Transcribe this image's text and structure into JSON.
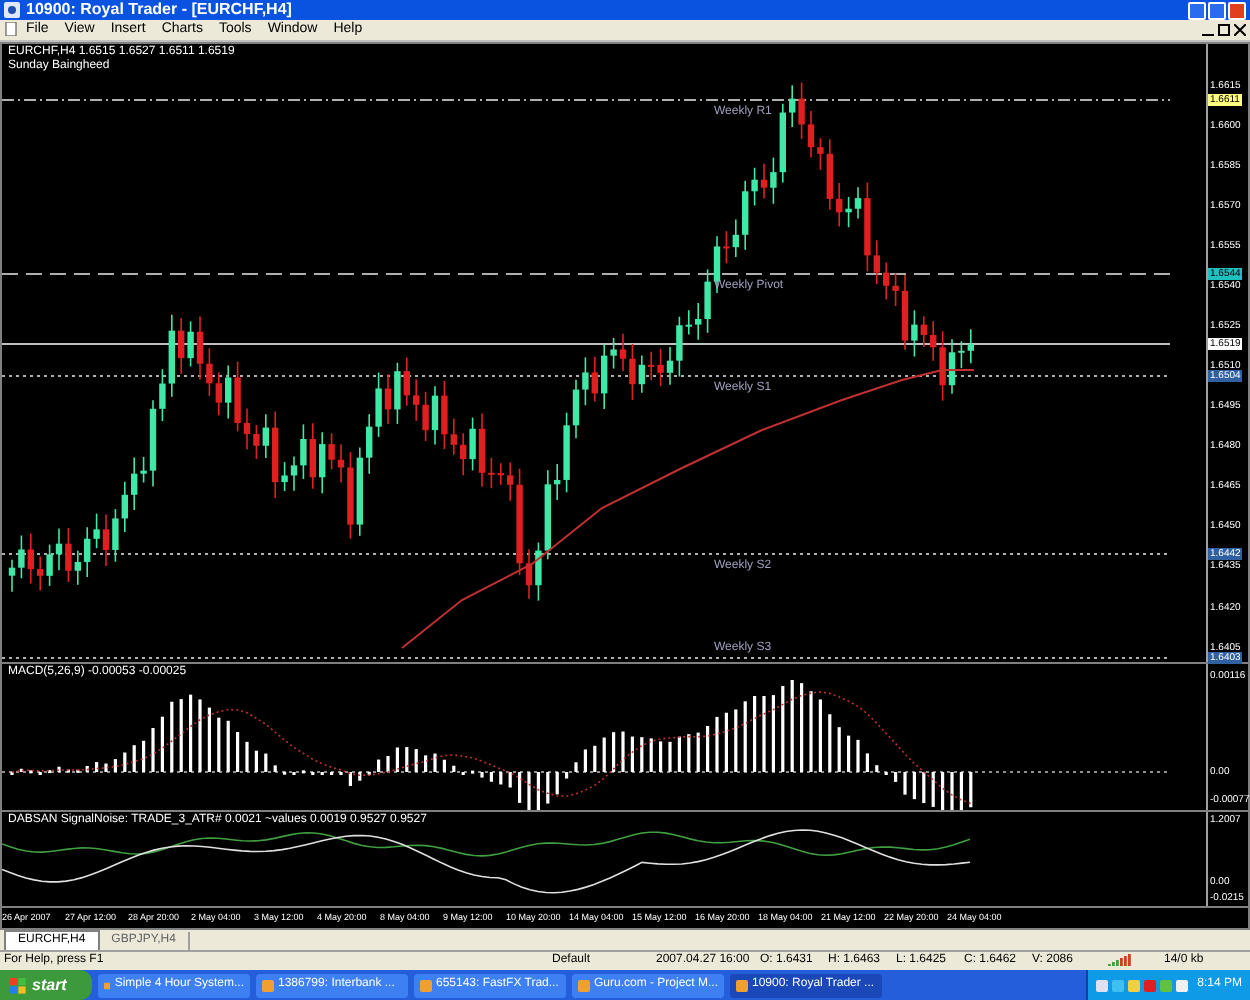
{
  "window": {
    "title": "10900: Royal Trader - [EURCHF,H4]"
  },
  "menu": [
    "File",
    "View",
    "Insert",
    "Charts",
    "Tools",
    "Window",
    "Help"
  ],
  "chart": {
    "header": [
      "EURCHF,H4  1.6515 1.6527 1.6511 1.6519",
      "Sunday Baingheed"
    ],
    "price_ticks": [
      "1.6615",
      "1.6600",
      "1.6585",
      "1.6570",
      "1.6555",
      "1.6540",
      "1.6525",
      "1.6510",
      "1.6495",
      "1.6480",
      "1.6465",
      "1.6450",
      "1.6435",
      "1.6420",
      "1.6405"
    ],
    "levels": [
      {
        "kind": "dashdot",
        "price": "1.6611",
        "label": "Weekly R1",
        "color": "#ffff80"
      },
      {
        "kind": "dashed",
        "price": "1.6544",
        "label": "Weekly Pivot",
        "color": "#20c0c0"
      },
      {
        "kind": "solid",
        "price": "1.6519",
        "color": "#ffffff"
      },
      {
        "kind": "dotted",
        "price": "1.6504",
        "label": "Weekly S1",
        "color": "#3060a0"
      },
      {
        "kind": "dotted",
        "price": "1.6442",
        "label": "Weekly S2",
        "color": "#3060a0"
      },
      {
        "kind": "dotted",
        "price": "1.6403",
        "label": "Weekly S3",
        "color": "#3060a0"
      }
    ]
  },
  "macd": {
    "label": "MACD(5,26,9) -0.00053 -0.00025",
    "axis": [
      "0.00116",
      "0.00",
      "-0.00077"
    ]
  },
  "indicator": {
    "label": "DABSAN SignalNoise: TRADE_3_ATR# 0.0021 ~values 0.0019 0.9527 0.9527",
    "axis": [
      "1.2007",
      "0.00",
      "-0.0215"
    ]
  },
  "time_labels": [
    "26 Apr 2007",
    "27 Apr 12:00",
    "28 Apr 20:00",
    "2 May 04:00",
    "3 May 12:00",
    "4 May 20:00",
    "8 May 04:00",
    "9 May 12:00",
    "10 May 20:00",
    "14 May 04:00",
    "15 May 12:00",
    "16 May 20:00",
    "18 May 04:00",
    "21 May 12:00",
    "22 May 20:00",
    "24 May 04:00"
  ],
  "tabs": [
    {
      "label": "EURCHF,H4",
      "selected": true
    },
    {
      "label": "GBPJPY,H4",
      "selected": false
    }
  ],
  "status_bar": {
    "help": "For Help, press F1",
    "profile": "Default",
    "fields": [
      "2007.04.27 16:00",
      "O: 1.6431",
      "H: 1.6463",
      "L: 1.6425",
      "C: 1.6462",
      "V: 2086"
    ],
    "traffic": "14/0 kb"
  },
  "taskbar": {
    "start": "start",
    "items": [
      {
        "label": "Simple 4 Hour System...",
        "selected": false
      },
      {
        "label": "1386799: Interbank ...",
        "selected": false
      },
      {
        "label": "655143: FastFX Trad...",
        "selected": false
      },
      {
        "label": "Guru.com - Project M...",
        "selected": false
      },
      {
        "label": "10900: Royal Trader ...",
        "selected": true
      }
    ],
    "clock": "8:14 PM"
  }
}
